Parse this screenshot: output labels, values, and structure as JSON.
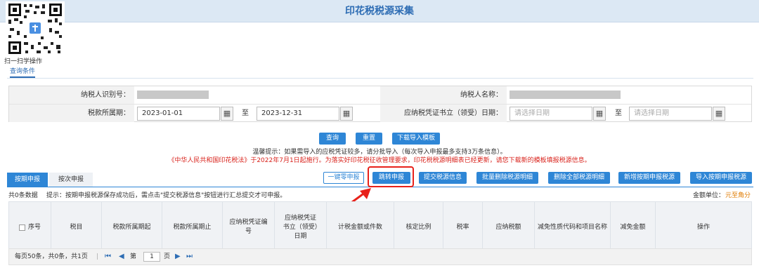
{
  "header": {
    "title": "印花税税源采集"
  },
  "qr": {
    "caption": "扫一扫学操作"
  },
  "query_tab": "查询条件",
  "form": {
    "taxpayer_id_label": "纳税人识别号：",
    "taxpayer_name_label": "纳税人名称：",
    "period_label": "税款所属期：",
    "period_start": "2023-01-01",
    "period_end": "2023-12-31",
    "to_label": "至",
    "voucher_date_label": "应纳税凭证书立（领受）日期：",
    "date_placeholder": "请选择日期"
  },
  "actions": {
    "query": "查询",
    "reset": "重置",
    "download_template": "下载导入模板"
  },
  "tips": {
    "line1": "温馨提示：如果需导入的应税凭证较多，请分批导入（每次导入申报最多支持3万条信息）。",
    "line2": "《中华人民共和国印花税法》于2022年7月1日起施行。为落实好印花税征收管理要求，印花税税源明细表已经更新，请您下载新的模板填报税源信息。"
  },
  "tabs": {
    "periodic": "按期申报",
    "per_transaction": "按次申报"
  },
  "toolbar": {
    "zero_declare": "一键零申报",
    "jump_declare": "跳转申报",
    "submit_source": "提交税源信息",
    "batch_delete": "批量删除税源明细",
    "delete_all": "删除全部税源明细",
    "add_periodic": "新增按期申报税源",
    "import_periodic": "导入按期申报税源"
  },
  "list_info": {
    "count": "共0条数据",
    "hint": "提示：按期申报税源保存成功后，需点击\"提交税源信息\"按钮进行汇总提交才可申报。",
    "unit_label": "金额单位：",
    "unit_value": "元至角分"
  },
  "table": {
    "columns": [
      "序号",
      "税目",
      "税款所属期起",
      "税款所属期止",
      "应纳税凭证编号",
      "应纳税凭证书立（领受）日期",
      "计税金额或件数",
      "核定比例",
      "税率",
      "应纳税额",
      "减免性质代码和项目名称",
      "减免金额",
      "操作"
    ]
  },
  "pager": {
    "summary": "每页50条，共0条，共1页",
    "page_prefix": "第",
    "page_value": "1",
    "page_suffix": "页"
  },
  "colors": {
    "accent": "#2e86d6",
    "title": "#2e6db4",
    "warning": "#d9231c",
    "highlight": "#e8211a"
  }
}
